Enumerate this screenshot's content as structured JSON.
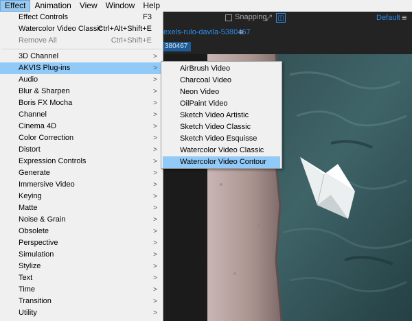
{
  "menubar": {
    "items": [
      {
        "label": "Effect",
        "active": true
      },
      {
        "label": "Animation",
        "active": false
      },
      {
        "label": "View",
        "active": false
      },
      {
        "label": "Window",
        "active": false
      },
      {
        "label": "Help",
        "active": false
      }
    ]
  },
  "toolbar": {
    "snapping_label": "Snapping",
    "workspace_label": "Default",
    "workspace_menu_icon": "hamburger-icon",
    "snap_icon": "snap-expand-icon",
    "snap_target_icon": "snap-target-icon"
  },
  "composition": {
    "tab_label": "exels-rulo-davila-5380467",
    "tab_menu_icon": "hamburger-icon",
    "subtab_label": "380467"
  },
  "effect_menu": {
    "items": [
      {
        "label": "Effect Controls",
        "shortcut": "F3"
      },
      {
        "label": "Watercolor Video Classic",
        "shortcut": "Ctrl+Alt+Shift+E"
      },
      {
        "label": "Remove All",
        "shortcut": "Ctrl+Shift+E",
        "disabled": true
      },
      {
        "label": "3D Channel",
        "submenu": true
      },
      {
        "label": "AKVIS Plug-ins",
        "submenu": true,
        "highlighted": true
      },
      {
        "label": "Audio",
        "submenu": true
      },
      {
        "label": "Blur & Sharpen",
        "submenu": true
      },
      {
        "label": "Boris FX Mocha",
        "submenu": true
      },
      {
        "label": "Channel",
        "submenu": true
      },
      {
        "label": "Cinema 4D",
        "submenu": true
      },
      {
        "label": "Color Correction",
        "submenu": true
      },
      {
        "label": "Distort",
        "submenu": true
      },
      {
        "label": "Expression Controls",
        "submenu": true
      },
      {
        "label": "Generate",
        "submenu": true
      },
      {
        "label": "Immersive Video",
        "submenu": true
      },
      {
        "label": "Keying",
        "submenu": true
      },
      {
        "label": "Matte",
        "submenu": true
      },
      {
        "label": "Noise & Grain",
        "submenu": true
      },
      {
        "label": "Obsolete",
        "submenu": true
      },
      {
        "label": "Perspective",
        "submenu": true
      },
      {
        "label": "Simulation",
        "submenu": true
      },
      {
        "label": "Stylize",
        "submenu": true
      },
      {
        "label": "Text",
        "submenu": true
      },
      {
        "label": "Time",
        "submenu": true
      },
      {
        "label": "Transition",
        "submenu": true
      },
      {
        "label": "Utility",
        "submenu": true
      }
    ]
  },
  "akvis_submenu": {
    "items": [
      {
        "label": "AirBrush Video"
      },
      {
        "label": "Charcoal Video"
      },
      {
        "label": "Neon Video"
      },
      {
        "label": "OilPaint Video"
      },
      {
        "label": "Sketch Video Artistic"
      },
      {
        "label": "Sketch Video Classic"
      },
      {
        "label": "Sketch Video Esquisse"
      },
      {
        "label": "Watercolor Video Classic"
      },
      {
        "label": "Watercolor Video Contour",
        "highlighted": true
      }
    ]
  },
  "colors": {
    "menu_bg": "#f0f0f0",
    "highlight": "#91c9f7",
    "accent_blue": "#2d8ceb",
    "panel_bg": "#232323"
  }
}
